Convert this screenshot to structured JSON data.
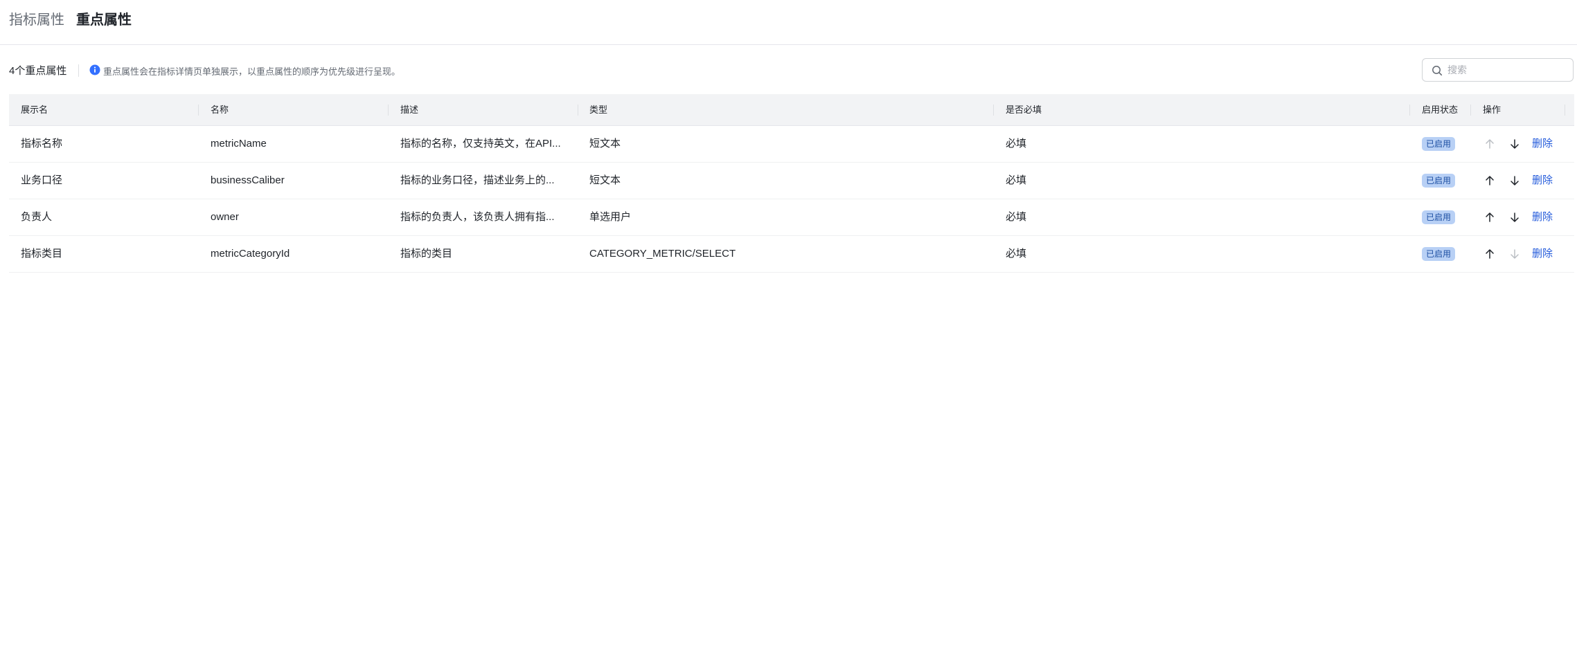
{
  "tabs": [
    {
      "label": "指标属性",
      "active": false
    },
    {
      "label": "重点属性",
      "active": true
    }
  ],
  "toolbar": {
    "count_label": "4个重点属性",
    "info_text": "重点属性会在指标详情页单独展示，以重点属性的顺序为优先级进行呈现。",
    "search_placeholder": "搜索"
  },
  "table": {
    "columns": [
      "展示名",
      "名称",
      "描述",
      "类型",
      "是否必填",
      "启用状态",
      "操作"
    ],
    "rows": [
      {
        "display_name": "指标名称",
        "name": "metricName",
        "description": "指标的名称，仅支持英文，在API...",
        "type": "短文本",
        "required": "必填",
        "status": "已启用",
        "up_enabled": false,
        "down_enabled": true,
        "delete_label": "删除"
      },
      {
        "display_name": "业务口径",
        "name": "businessCaliber",
        "description": "指标的业务口径，描述业务上的...",
        "type": "短文本",
        "required": "必填",
        "status": "已启用",
        "up_enabled": true,
        "down_enabled": true,
        "delete_label": "删除"
      },
      {
        "display_name": "负责人",
        "name": "owner",
        "description": "指标的负责人，该负责人拥有指...",
        "type": "单选用户",
        "required": "必填",
        "status": "已启用",
        "up_enabled": true,
        "down_enabled": true,
        "delete_label": "删除"
      },
      {
        "display_name": "指标类目",
        "name": "metricCategoryId",
        "description": "指标的类目",
        "type": "CATEGORY_METRIC/SELECT",
        "required": "必填",
        "status": "已启用",
        "up_enabled": true,
        "down_enabled": false,
        "delete_label": "删除"
      }
    ]
  },
  "colors": {
    "accent": "#245bdb",
    "info": "#3370ff",
    "badge_bg": "#b8d0f5",
    "badge_text": "#1d4fa3",
    "header_bg": "#f2f3f5",
    "arrow_enabled": "#1f2329",
    "arrow_disabled": "#bbbfc4"
  },
  "icons": {
    "info": "info-circle-icon",
    "search": "search-icon",
    "up": "arrow-up-icon",
    "down": "arrow-down-icon"
  }
}
